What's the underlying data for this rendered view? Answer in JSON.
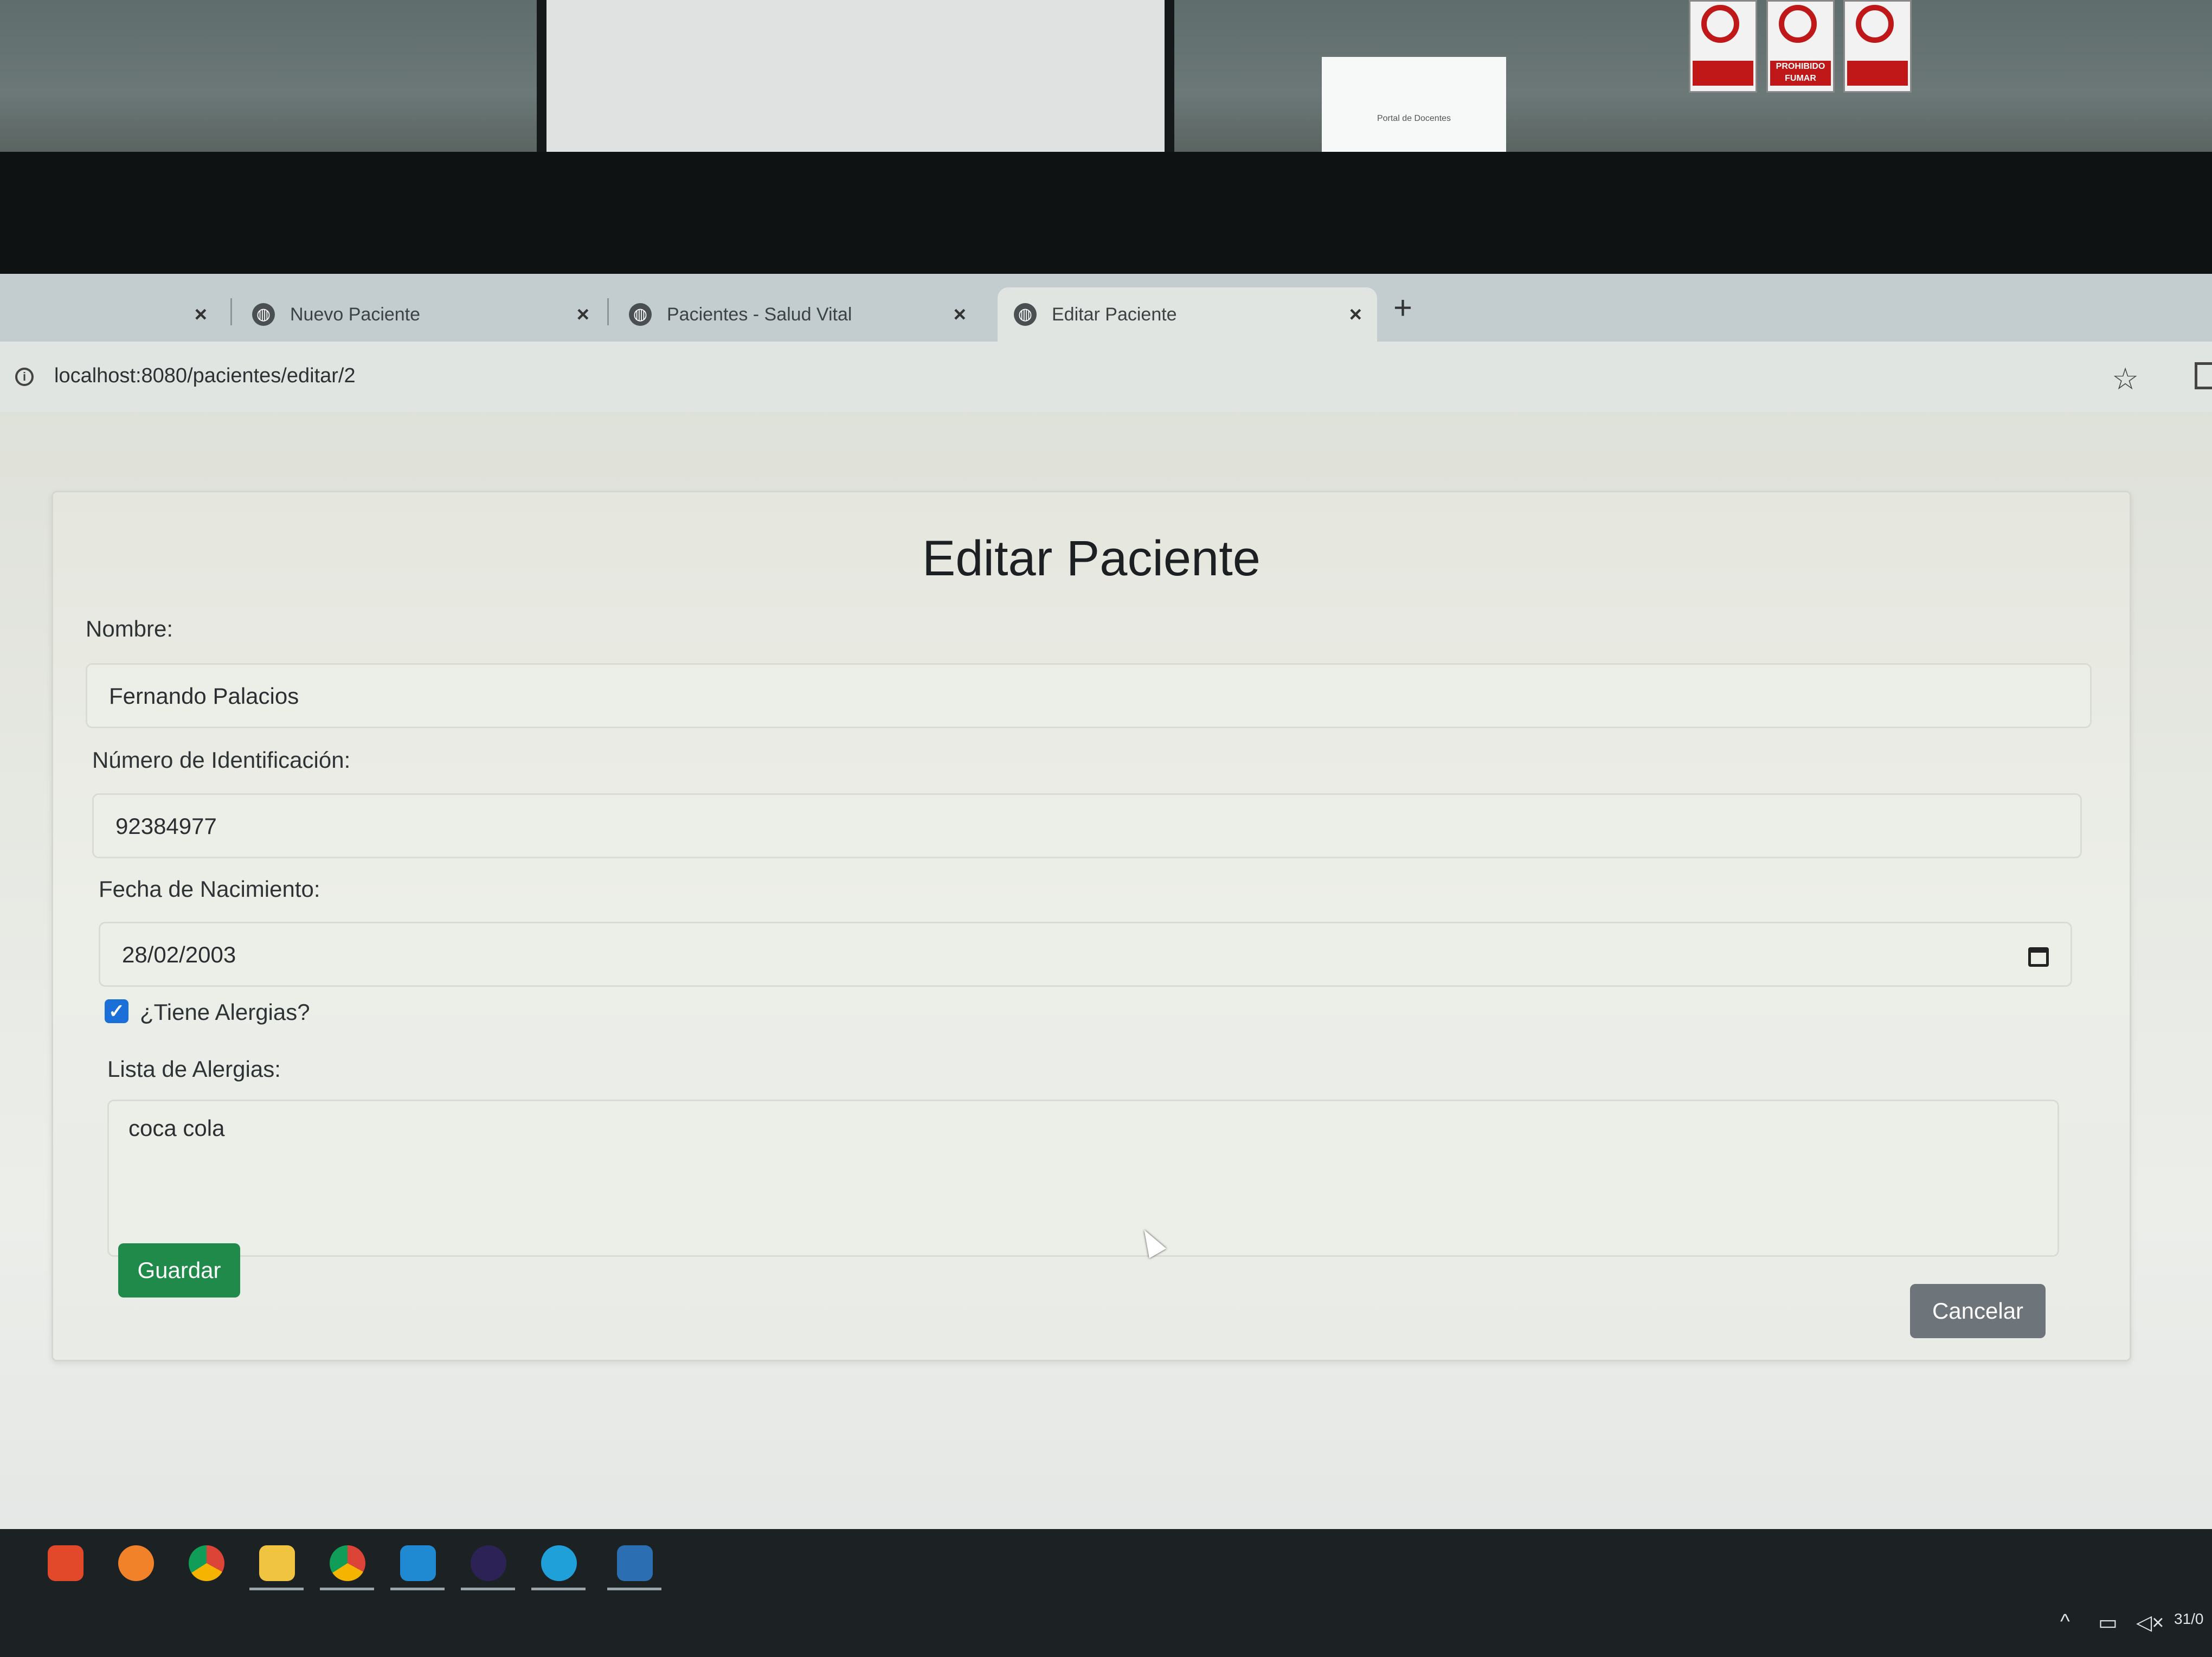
{
  "environment": {
    "background_dialog_title": "Portal de Docentes",
    "signs": [
      "",
      "PROHIBIDO FUMAR",
      ""
    ]
  },
  "browser": {
    "tabs": [
      {
        "title": "",
        "close": "×"
      },
      {
        "title": "Nuevo Paciente",
        "close": "×",
        "icon": "globe-icon"
      },
      {
        "title": "Pacientes - Salud Vital",
        "close": "×",
        "icon": "globe-icon"
      },
      {
        "title": "Editar Paciente",
        "close": "×",
        "icon": "globe-icon",
        "active": true
      }
    ],
    "new_tab": "+",
    "url": "localhost:8080/pacientes/editar/2"
  },
  "form": {
    "title": "Editar Paciente",
    "nombre_label": "Nombre:",
    "nombre_value": "Fernando Palacios",
    "id_label": "Número de Identificación:",
    "id_value": "92384977",
    "fecha_label": "Fecha de Nacimiento:",
    "fecha_value": "28/02/2003",
    "alergias_check_label": "¿Tiene Alergias?",
    "alergias_checked": true,
    "lista_label": "Lista de Alergias:",
    "lista_value": "coca cola",
    "save_label": "Guardar",
    "cancel_label": "Cancelar"
  },
  "colors": {
    "save_button": "#1f8a4a",
    "cancel_button": "#6d757b",
    "checkbox": "#1a6fd8"
  },
  "taskbar": {
    "icons": [
      "brave-icon",
      "firefox-icon",
      "chrome-icon",
      "file-explorer-icon",
      "chrome-icon",
      "vscode-icon",
      "eclipse-icon",
      "edge-icon",
      "mysql-workbench-icon"
    ],
    "date_partial": "31/0"
  }
}
